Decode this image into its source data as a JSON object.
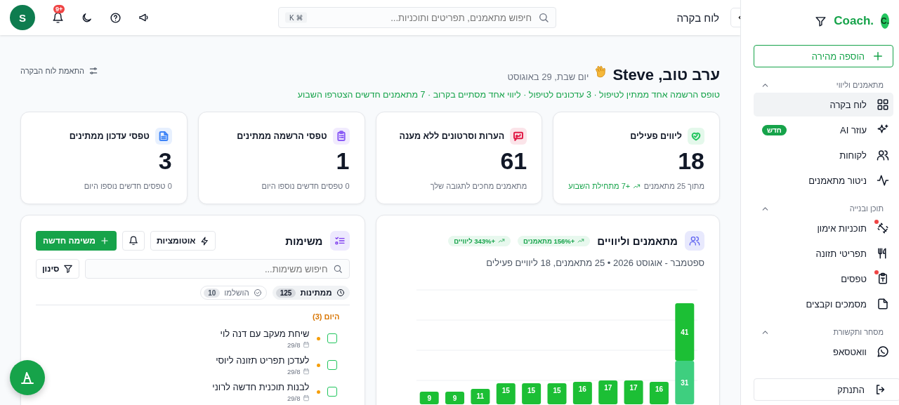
{
  "sidebar": {
    "logo_mark": "C.",
    "logo_text": "Coach.",
    "quick_add": "הוספה מהירה",
    "sections": [
      {
        "title": "מתאמנים וליווי",
        "expanded": true,
        "items": [
          {
            "label": "לוח בקרה",
            "selected": true,
            "dot": false
          },
          {
            "label": "עוזר AI",
            "selected": false,
            "dot": false,
            "badge": "חדש"
          },
          {
            "label": "לקוחות",
            "selected": false,
            "dot": false
          },
          {
            "label": "ניטור מתאמנים",
            "selected": false,
            "dot": false
          }
        ]
      },
      {
        "title": "תוכן ובנייה",
        "expanded": true,
        "items": [
          {
            "label": "תוכניות אימון",
            "selected": false,
            "dot": true
          },
          {
            "label": "תפריטי תזונה",
            "selected": false,
            "dot": false
          },
          {
            "label": "טפסים",
            "selected": false,
            "dot": true
          },
          {
            "label": "מסמכים וקבצים",
            "selected": false,
            "dot": false
          }
        ]
      },
      {
        "title": "מסחר ותקשורת",
        "expanded": true,
        "items": [
          {
            "label": "וואטסאפ",
            "selected": false,
            "dot": false
          }
        ]
      }
    ],
    "logout": "התנתק"
  },
  "header": {
    "title": "לוח בקרה",
    "search_placeholder": "חיפוש מתאמנים, תפריטים ותוכניות...",
    "shortcut": "⌘ K",
    "notification_count": "+9",
    "avatar": "S"
  },
  "greeting": {
    "title": "ערב טוב, Steve",
    "date": "יום שבת, 29 באוגוסט",
    "summary": "טופס הרשמה אחד ממתין לטיפול · 3 עדכונים לטיפול · ליווי אחד מסתיים בקרוב · 7 מתאמנים חדשים הצטרפו השבוע",
    "customize": "התאמת לוח הבקרה"
  },
  "stats": [
    {
      "title": "ליווים פעילים",
      "value": "18",
      "note": "מתוך 25 מתאמנים",
      "trend": "+7 מתחילת השבוע",
      "color": "#22c55e"
    },
    {
      "title": "הערות וסרטונים ללא מענה",
      "value": "61",
      "note": "מתאמנים מחכים לתגובה שלך",
      "color": "#e11d48"
    },
    {
      "title": "טפסי הרשמה ממתינים",
      "value": "1",
      "note": "0 טפסים חדשים נוספו היום",
      "color": "#8b5cf6"
    },
    {
      "title": "טפסי עדכון ממתינים",
      "value": "3",
      "note": "0 טפסים חדשים נוספו היום",
      "color": "#3b82f6"
    }
  ],
  "chart_card": {
    "title": "מתאמנים וליוויים",
    "badges": [
      "+156% מתאמנים",
      "+343% ליוויים"
    ],
    "subtitle": "ספטמבר - אוגוסט 2026 • 25 מתאמנים, 18 ליוויים פעילים",
    "chart_data": {
      "type": "bar",
      "stacked": true,
      "data_labels": true,
      "categories": [
        null,
        null,
        null,
        null,
        null,
        null,
        null,
        null,
        null,
        null,
        null
      ],
      "series": [
        {
          "color": "#3ecf7f",
          "values": [
            null,
            null,
            null,
            null,
            null,
            null,
            null,
            null,
            null,
            null,
            31
          ]
        },
        {
          "color": "#1cbf35",
          "values": [
            9,
            9,
            11,
            15,
            15,
            15,
            16,
            17,
            17,
            16,
            41
          ]
        }
      ]
    }
  },
  "tasks": {
    "title": "משימות",
    "automations": "אוטומציות",
    "new_task": "משימה חדשה",
    "search_placeholder": "חיפוש משימות...",
    "filter": "סינון",
    "tabs": [
      {
        "label": "ממתינות",
        "count": "125",
        "selected": true
      },
      {
        "label": "הושלמו",
        "count": "10",
        "selected": false
      }
    ],
    "group": "היום (3)",
    "items": [
      {
        "title": "שיחת מעקב עם דנה לוי",
        "date": "29/8",
        "checked": false,
        "color": "#f59e0b"
      },
      {
        "title": "לעדכן תפריט תזונה ליוסי",
        "date": "29/8",
        "checked": false,
        "color": "#f59e0b"
      },
      {
        "title": "לבנות תוכנית חדשה לרוני",
        "date": "29/8",
        "checked": false,
        "color": "#f59e0b"
      }
    ]
  }
}
